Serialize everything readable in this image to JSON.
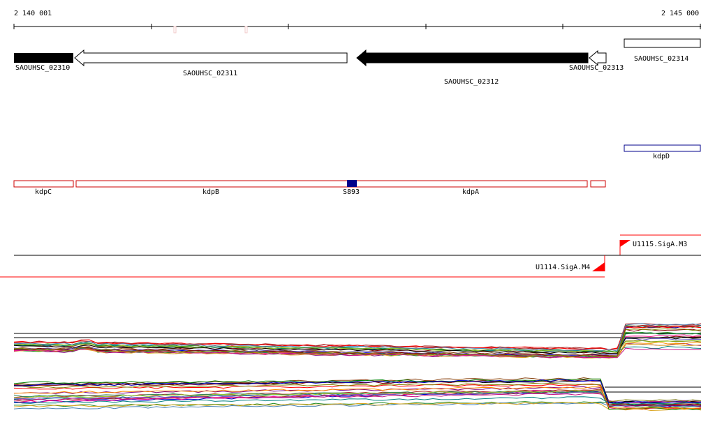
{
  "ruler": {
    "start_label": "2 140 001",
    "end_label": "2 145 000"
  },
  "genes": [
    {
      "id": "SAOUHSC_02310",
      "label": "SAOUHSC_02310",
      "strand": "-",
      "style": "filled"
    },
    {
      "id": "SAOUHSC_02311",
      "label": "SAOUHSC_02311",
      "strand": "-",
      "style": "outline"
    },
    {
      "id": "SAOUHSC_02312",
      "label": "SAOUHSC_02312",
      "strand": "-",
      "style": "filled"
    },
    {
      "id": "SAOUHSC_02313",
      "label": "SAOUHSC_02313",
      "strand": "-",
      "style": "outline"
    },
    {
      "id": "SAOUHSC_02314",
      "label": "SAOUHSC_02314",
      "strand": "+",
      "style": "outline"
    }
  ],
  "names_track": {
    "kdpD": "kdpD",
    "kdpC": "kdpC",
    "kdpB": "kdpB",
    "S893": "S893",
    "kdpA": "kdpA"
  },
  "transcription_units": [
    {
      "id": "U1115",
      "label": "U1115.SigA.M3",
      "strand": "+"
    },
    {
      "id": "U1114",
      "label": "U1114.SigA.M4",
      "strand": "-"
    }
  ],
  "colors": {
    "gene_fill": "#000000",
    "operon_outline": "#cc0000",
    "kdpD_outline": "#00008b",
    "srna_fill": "#00008b",
    "tss_red": "#ff0000",
    "ruler": "#000000"
  },
  "expression_line_colors": [
    "#800000",
    "#808000",
    "#008000",
    "#800080",
    "#ff8c00",
    "#008080",
    "#0000cd",
    "#a52a2a",
    "#ff1493",
    "#228b22",
    "#8b4513",
    "#6a5acd",
    "#b22222",
    "#2e8b57",
    "#9acd32",
    "#000000",
    "#ff0000",
    "#4682b4",
    "#daa520",
    "#c71585"
  ]
}
